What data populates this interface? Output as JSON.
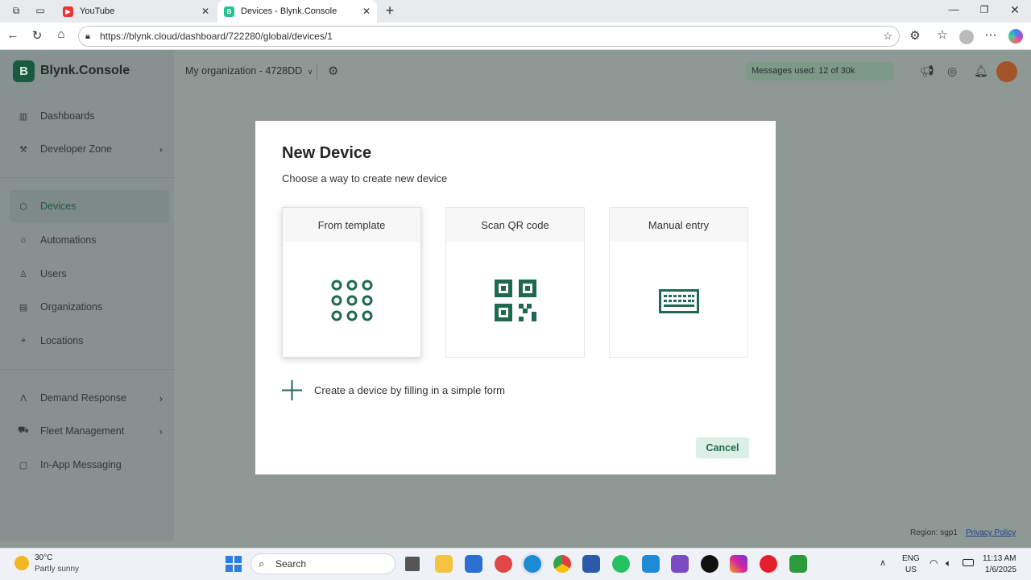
{
  "browser": {
    "tabs": [
      {
        "label": "YouTube",
        "favicon": "youtube-icon"
      },
      {
        "label": "Devices - Blynk.Console",
        "favicon": "blynk-icon"
      }
    ],
    "url": "https://blynk.cloud/dashboard/722280/global/devices/1"
  },
  "app": {
    "brand_letter": "B",
    "brand": "Blynk.Console",
    "organization": "My organization - 4728DD",
    "messages": "Messages used: 12 of 30k",
    "sidebar": [
      {
        "label": "Dashboards",
        "icon": "chart-icon"
      },
      {
        "label": "Developer Zone",
        "icon": "tools-icon",
        "chevron": true
      },
      {
        "label": "Devices",
        "icon": "cube-icon",
        "selected": true
      },
      {
        "label": "Automations",
        "icon": "sun-icon"
      },
      {
        "label": "Users",
        "icon": "user-icon"
      },
      {
        "label": "Organizations",
        "icon": "building-icon"
      },
      {
        "label": "Locations",
        "icon": "pin-icon"
      },
      {
        "label": "Demand Response",
        "icon": "response-icon",
        "chevron": true
      },
      {
        "label": "Fleet Management",
        "icon": "truck-icon",
        "chevron": true
      },
      {
        "label": "In-App Messaging",
        "icon": "message-icon"
      }
    ],
    "footer": {
      "region": "Region: sgp1",
      "privacy": "Privacy Policy"
    }
  },
  "modal": {
    "title": "New Device",
    "subtitle": "Choose a way to create new device",
    "options": [
      {
        "label": "From template",
        "icon": "template-grid-icon"
      },
      {
        "label": "Scan QR code",
        "icon": "qr-code-icon"
      },
      {
        "label": "Manual entry",
        "icon": "keyboard-icon"
      }
    ],
    "form_link": "Create a device by filling in a simple form",
    "cancel": "Cancel",
    "accent": "#1f6a4d"
  },
  "taskbar": {
    "weather_temp": "30°C",
    "weather_desc": "Partly sunny",
    "search": "Search",
    "lang1": "ENG",
    "lang2": "US",
    "time": "11:13 AM",
    "date": "1/6/2025"
  }
}
